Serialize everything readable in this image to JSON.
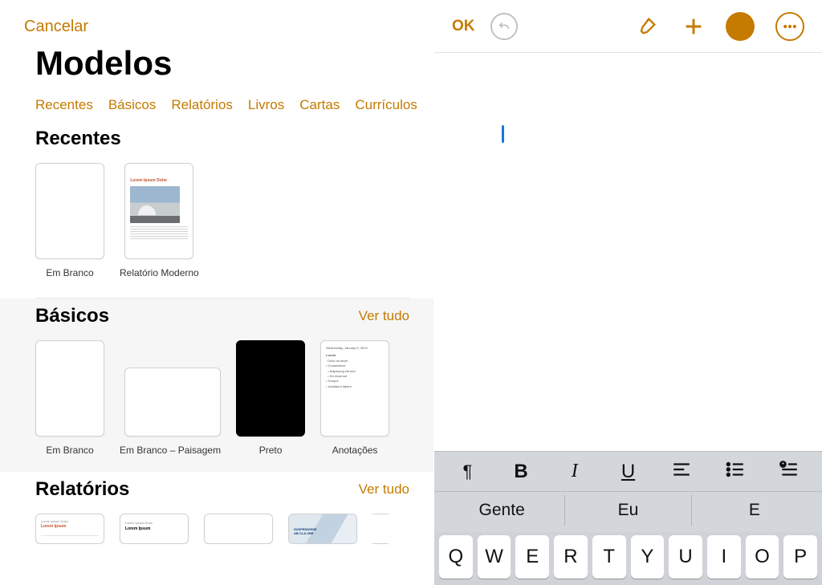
{
  "accent": "#c57a00",
  "left": {
    "cancel": "Cancelar",
    "title": "Modelos",
    "tabs": [
      "Recentes",
      "Básicos",
      "Relatórios",
      "Livros",
      "Cartas",
      "Currículos"
    ],
    "see_all": "Ver tudo",
    "sections": {
      "recentes": {
        "title": "Recentes",
        "items": [
          {
            "label": "Em Branco"
          },
          {
            "label": "Relatório Moderno"
          }
        ]
      },
      "basicos": {
        "title": "Básicos",
        "items": [
          {
            "label": "Em Branco"
          },
          {
            "label": "Em Branco – Paisagem"
          },
          {
            "label": "Preto"
          },
          {
            "label": "Anotações"
          }
        ]
      },
      "relatorios": {
        "title": "Relatórios",
        "items": [
          {
            "label": ""
          },
          {
            "label": ""
          },
          {
            "label": ""
          },
          {
            "label": ""
          },
          {
            "label": ""
          }
        ]
      }
    }
  },
  "right": {
    "ok": "OK",
    "format_buttons": {
      "pilcrow": "¶",
      "bold": "B",
      "italic": "I",
      "underline": "U"
    },
    "suggestions": [
      "Gente",
      "Eu",
      "E"
    ],
    "key_row": [
      "Q",
      "W",
      "E",
      "R",
      "T",
      "Y",
      "U",
      "I",
      "O",
      "P"
    ]
  }
}
